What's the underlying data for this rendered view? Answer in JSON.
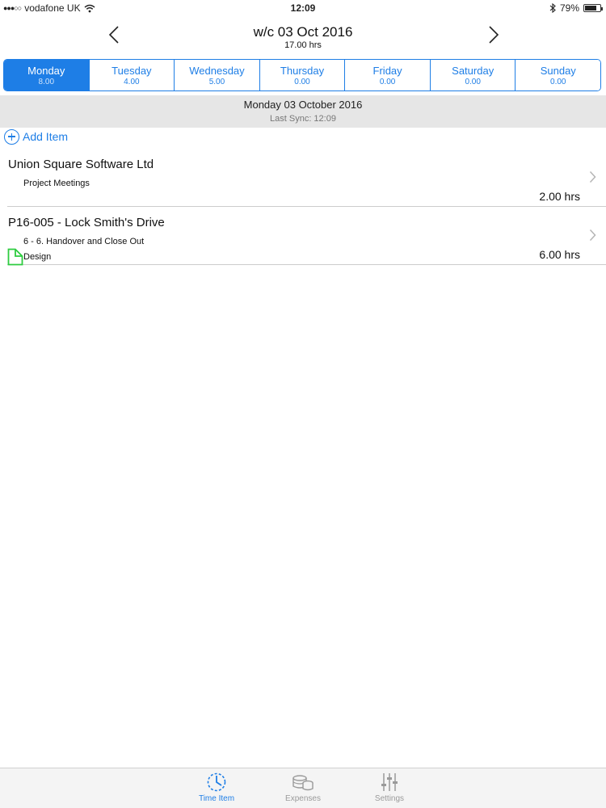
{
  "status_bar": {
    "carrier": "vodafone UK",
    "time": "12:09",
    "battery_percent": "79%",
    "battery_level": 0.79
  },
  "header": {
    "week_title": "w/c 03 Oct 2016",
    "week_total": "17.00 hrs"
  },
  "days": [
    {
      "name": "Monday",
      "hours": "8.00",
      "active": true
    },
    {
      "name": "Tuesday",
      "hours": "4.00",
      "active": false
    },
    {
      "name": "Wednesday",
      "hours": "5.00",
      "active": false
    },
    {
      "name": "Thursday",
      "hours": "0.00",
      "active": false
    },
    {
      "name": "Friday",
      "hours": "0.00",
      "active": false
    },
    {
      "name": "Saturday",
      "hours": "0.00",
      "active": false
    },
    {
      "name": "Sunday",
      "hours": "0.00",
      "active": false
    }
  ],
  "banner": {
    "date": "Monday 03 October 2016",
    "sync": "Last Sync: 12:09"
  },
  "add_item_label": "Add Item",
  "entries": [
    {
      "title": "Union Square Software Ltd",
      "line1": "Project Meetings",
      "line2": "",
      "hours": "2.00 hrs",
      "has_doc_icon": false
    },
    {
      "title": "P16-005 - Lock Smith's Drive",
      "line1": "6 - 6. Handover and Close Out",
      "line2": "Design",
      "hours": "6.00 hrs",
      "has_doc_icon": true
    }
  ],
  "tab_bar": {
    "time_item": "Time Item",
    "expenses": "Expenses",
    "settings": "Settings"
  },
  "colors": {
    "accent": "#1e7ee6",
    "banner_bg": "#e6e6e6",
    "doc_icon": "#2ecc40",
    "inactive_tab": "#9a9a9a"
  },
  "icons": {
    "wifi": "wifi-icon",
    "bluetooth": "bluetooth-icon",
    "battery": "battery-icon",
    "prev": "chevron-left-icon",
    "next": "chevron-right-icon",
    "add": "add-circle-icon",
    "disclosure": "chevron-right-icon",
    "document": "document-icon",
    "time_item": "clock-icon",
    "expenses": "coins-icon",
    "settings": "sliders-icon"
  }
}
